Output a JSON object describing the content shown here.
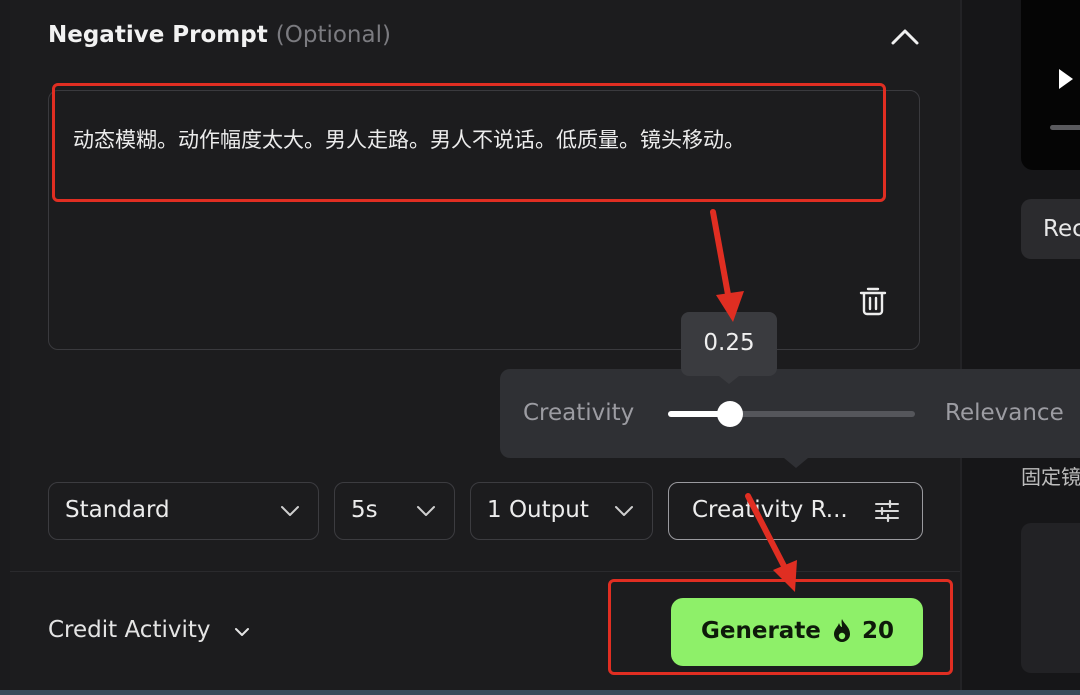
{
  "negative_prompt": {
    "title": "Negative Prompt",
    "optional": "(Optional)",
    "text": "动态模糊。动作幅度太大。男人走路。男人不说话。低质量。镜头移动。"
  },
  "slider": {
    "tooltip": "0.25",
    "value": 0.25,
    "left_label": "Creativity",
    "right_label": "Relevance"
  },
  "settings": {
    "mode": "Standard",
    "duration": "5s",
    "outputs": "1 Output",
    "creativity": "Creativity R..."
  },
  "footer": {
    "credit_activity": "Credit Activity",
    "generate_label": "Generate",
    "credits": "20"
  },
  "right_panel": {
    "rec_label": "Rec",
    "fixed_label": "固定镜"
  },
  "colors": {
    "accent_green": "#8ef069",
    "annotation_red": "#e02e22",
    "background": "#1c1c1e"
  },
  "icons": [
    "chevron-up-icon",
    "trash-icon",
    "chevron-down-icon",
    "filter-sliders-icon",
    "flame-icon",
    "play-icon"
  ]
}
